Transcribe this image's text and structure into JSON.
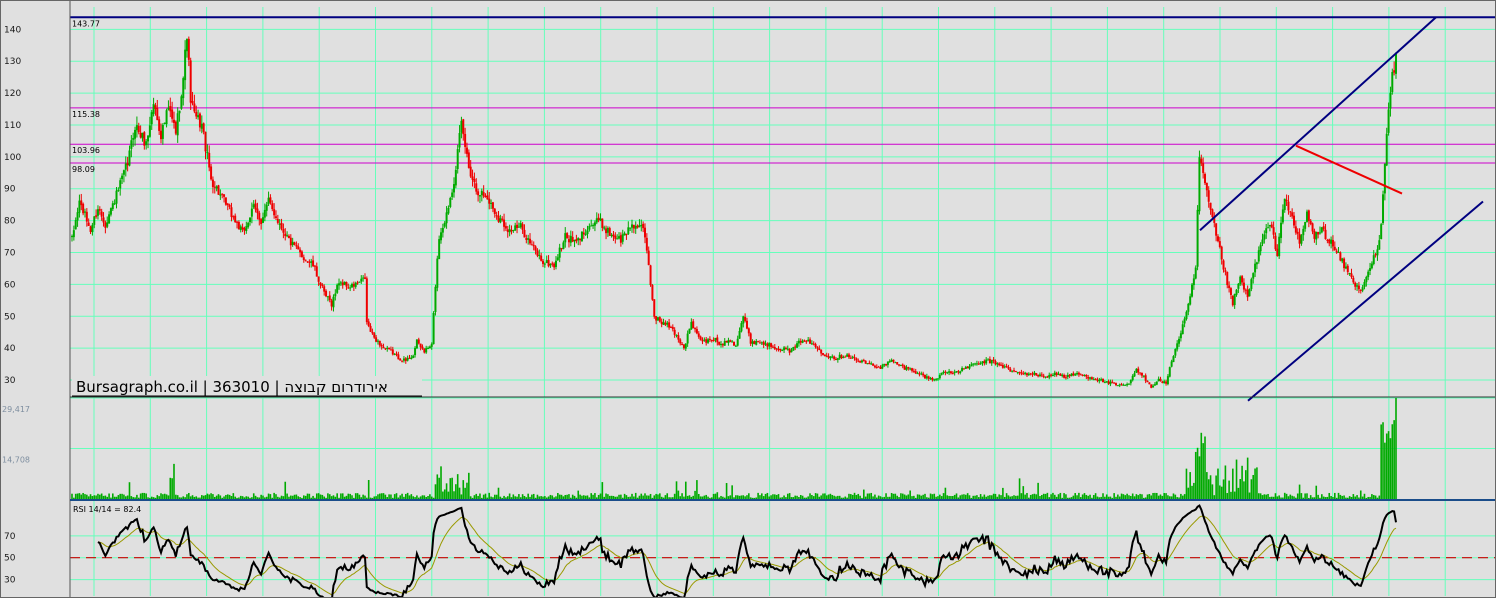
{
  "chart_data": {
    "type": "candlestick",
    "watermark": "Bursagraph.co.il | 363010 | אירודרום קבוצה",
    "price_axis": {
      "ticks": [
        "140",
        "130",
        "120",
        "110",
        "100",
        "90",
        "80",
        "70",
        "60",
        "50",
        "40",
        "30"
      ],
      "ylim": [
        25,
        147
      ]
    },
    "volume_axis": {
      "ticks": [
        "29,417",
        "14,708"
      ],
      "ylim": [
        0,
        29417
      ]
    },
    "rsi": {
      "label": "RSI 14/14 = 82.4",
      "value": 82.4,
      "ticks": [
        "70",
        "50",
        "30"
      ],
      "midline": 50,
      "ylim": [
        15,
        100
      ]
    },
    "horizontal_levels": [
      {
        "label": "143.77",
        "value": 143.77,
        "color": "#000080"
      },
      {
        "label": "115.38",
        "value": 115.38,
        "color": "#cc00cc"
      },
      {
        "label": "103.96",
        "value": 103.96,
        "color": "#cc00cc"
      },
      {
        "label": "98.09",
        "value": 98.09,
        "color": "#cc00cc"
      }
    ],
    "colors": {
      "up": "#00aa00",
      "down": "#ee0000",
      "grid": "#66ffbb",
      "channel": "#000080",
      "resistance": "#ee0000",
      "signal": "#999900"
    },
    "anchors": [
      [
        0,
        74
      ],
      [
        4,
        86
      ],
      [
        10,
        77
      ],
      [
        14,
        84
      ],
      [
        18,
        79
      ],
      [
        24,
        88
      ],
      [
        30,
        98
      ],
      [
        34,
        110
      ],
      [
        40,
        104
      ],
      [
        44,
        117
      ],
      [
        48,
        107
      ],
      [
        52,
        115
      ],
      [
        56,
        108
      ],
      [
        60,
        125
      ],
      [
        62,
        139
      ],
      [
        64,
        118
      ],
      [
        66,
        113
      ],
      [
        70,
        110
      ],
      [
        75,
        93
      ],
      [
        80,
        88
      ],
      [
        86,
        82
      ],
      [
        92,
        76
      ],
      [
        98,
        84
      ],
      [
        102,
        80
      ],
      [
        106,
        86
      ],
      [
        112,
        79
      ],
      [
        118,
        73
      ],
      [
        124,
        69
      ],
      [
        130,
        66
      ],
      [
        136,
        57
      ],
      [
        140,
        54
      ],
      [
        144,
        61
      ],
      [
        150,
        59
      ],
      [
        156,
        61
      ],
      [
        158,
        62
      ],
      [
        159,
        48
      ],
      [
        162,
        44
      ],
      [
        168,
        40
      ],
      [
        172,
        39
      ],
      [
        176,
        37
      ],
      [
        180,
        36
      ],
      [
        184,
        38
      ],
      [
        186,
        42
      ],
      [
        190,
        39
      ],
      [
        194,
        41
      ],
      [
        196,
        60
      ],
      [
        198,
        75
      ],
      [
        202,
        82
      ],
      [
        206,
        93
      ],
      [
        210,
        110
      ],
      [
        214,
        97
      ],
      [
        218,
        90
      ],
      [
        224,
        87
      ],
      [
        230,
        81
      ],
      [
        236,
        77
      ],
      [
        242,
        78
      ],
      [
        248,
        72
      ],
      [
        254,
        67
      ],
      [
        260,
        66
      ],
      [
        266,
        75
      ],
      [
        272,
        73
      ],
      [
        278,
        78
      ],
      [
        284,
        80
      ],
      [
        290,
        76
      ],
      [
        296,
        74
      ],
      [
        302,
        79
      ],
      [
        308,
        77
      ],
      [
        310,
        71
      ],
      [
        314,
        50
      ],
      [
        318,
        48
      ],
      [
        322,
        47
      ],
      [
        326,
        44
      ],
      [
        330,
        40
      ],
      [
        334,
        48
      ],
      [
        338,
        43
      ],
      [
        342,
        42
      ],
      [
        346,
        43
      ],
      [
        350,
        41
      ],
      [
        354,
        43
      ],
      [
        358,
        41
      ],
      [
        362,
        50
      ],
      [
        366,
        42
      ],
      [
        370,
        42
      ],
      [
        376,
        41
      ],
      [
        382,
        40
      ],
      [
        388,
        39
      ],
      [
        394,
        43
      ],
      [
        400,
        41
      ],
      [
        406,
        38
      ],
      [
        412,
        37
      ],
      [
        418,
        38
      ],
      [
        424,
        36
      ],
      [
        430,
        35
      ],
      [
        436,
        34
      ],
      [
        442,
        36
      ],
      [
        448,
        34
      ],
      [
        454,
        33
      ],
      [
        460,
        31
      ],
      [
        466,
        30
      ],
      [
        470,
        33
      ],
      [
        476,
        32
      ],
      [
        482,
        34
      ],
      [
        488,
        35
      ],
      [
        494,
        36
      ],
      [
        500,
        35
      ],
      [
        506,
        33
      ],
      [
        512,
        32
      ],
      [
        518,
        32
      ],
      [
        524,
        31
      ],
      [
        530,
        32
      ],
      [
        536,
        31
      ],
      [
        542,
        32
      ],
      [
        548,
        31
      ],
      [
        554,
        30
      ],
      [
        560,
        29
      ],
      [
        566,
        28
      ],
      [
        570,
        29
      ],
      [
        574,
        33
      ],
      [
        578,
        31
      ],
      [
        582,
        28
      ],
      [
        586,
        30
      ],
      [
        590,
        29
      ],
      [
        594,
        38
      ],
      [
        598,
        45
      ],
      [
        602,
        53
      ],
      [
        606,
        65
      ],
      [
        608,
        100
      ],
      [
        612,
        88
      ],
      [
        616,
        78
      ],
      [
        620,
        68
      ],
      [
        624,
        58
      ],
      [
        626,
        54
      ],
      [
        630,
        62
      ],
      [
        634,
        56
      ],
      [
        638,
        66
      ],
      [
        642,
        74
      ],
      [
        646,
        79
      ],
      [
        650,
        70
      ],
      [
        654,
        88
      ],
      [
        658,
        80
      ],
      [
        662,
        73
      ],
      [
        666,
        82
      ],
      [
        670,
        75
      ],
      [
        674,
        77
      ],
      [
        678,
        74
      ],
      [
        682,
        70
      ],
      [
        686,
        66
      ],
      [
        690,
        62
      ],
      [
        694,
        58
      ],
      [
        698,
        62
      ],
      [
        700,
        66
      ],
      [
        704,
        70
      ],
      [
        706,
        78
      ],
      [
        708,
        98
      ],
      [
        710,
        115
      ],
      [
        712,
        125
      ],
      [
        714,
        131
      ]
    ]
  }
}
